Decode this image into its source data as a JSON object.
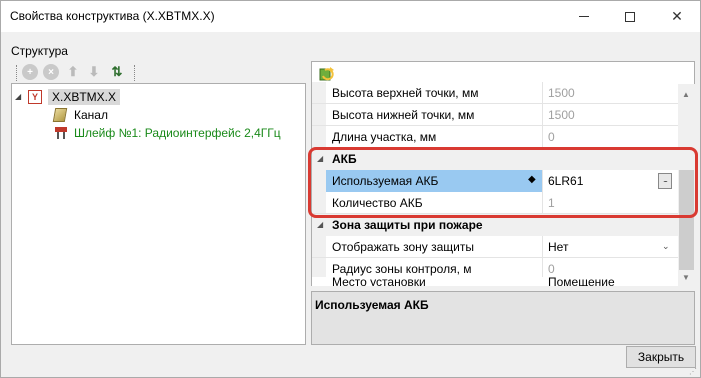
{
  "window": {
    "title": "Свойства конструктива (X.XBTMX.X)"
  },
  "left": {
    "section_label": "Структура",
    "toolbar": [
      "add-icon",
      "delete-icon",
      "move-up-icon",
      "move-down-icon",
      "sort-icon"
    ],
    "tree": {
      "root": {
        "label": "X.XBTMX.X",
        "icon": "Y"
      },
      "children": [
        {
          "label": "Канал"
        },
        {
          "label": "Шлейф №1: Радиоинтерфейс 2,4ГГц"
        }
      ]
    }
  },
  "properties": {
    "rows": [
      {
        "name": "Высота верхней точки, мм",
        "value": "1500"
      },
      {
        "name": "Высота нижней точки, мм",
        "value": "1500"
      },
      {
        "name": "Длина участка, мм",
        "value": "0"
      }
    ],
    "cat_akb": {
      "title": "АКБ",
      "rows": [
        {
          "name": "Используемая АКБ",
          "value": "6LR61",
          "ellipsis": "..."
        },
        {
          "name": "Количество АКБ",
          "value": "1"
        }
      ]
    },
    "cat_zone": {
      "title": "Зона защиты при пожаре",
      "rows": [
        {
          "name": "Отображать зону защиты",
          "value": "Нет"
        },
        {
          "name": "Радиус зоны контроля, м",
          "value": "0"
        },
        {
          "name": "Место установки",
          "value": "Помещение"
        }
      ]
    }
  },
  "description": {
    "title": "Используемая АКБ"
  },
  "buttons": {
    "close": "Закрыть"
  },
  "colors": {
    "selected_row": "#99c9f1",
    "highlight_border": "#d93a32",
    "tree_link": "#1a8a1a"
  }
}
